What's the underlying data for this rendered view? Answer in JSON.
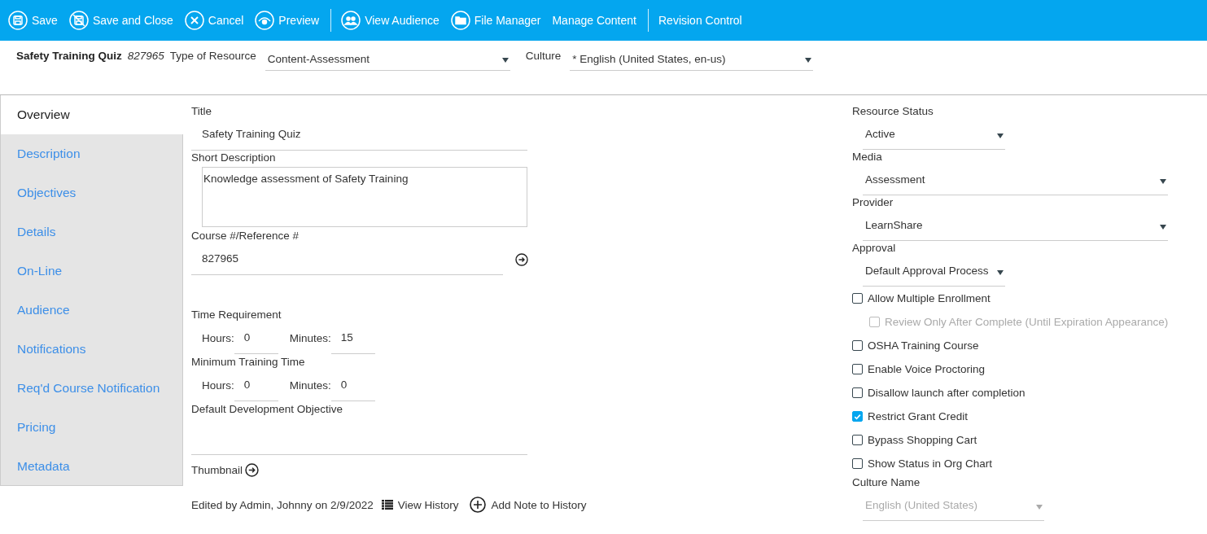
{
  "toolbar": {
    "groups": [
      [
        {
          "label": "Save",
          "kind": "save"
        },
        {
          "label": "Save and Close",
          "kind": "saveclose"
        },
        {
          "label": "Cancel",
          "kind": "cancel"
        },
        {
          "label": "Preview",
          "kind": "preview"
        }
      ],
      [
        {
          "label": "View Audience",
          "kind": "audience"
        },
        {
          "label": "File Manager",
          "kind": "folder"
        },
        {
          "label": "Manage Content",
          "kind": "text"
        }
      ],
      [
        {
          "label": "Revision Control",
          "kind": "text"
        }
      ]
    ]
  },
  "header": {
    "title": "Safety Training Quiz",
    "number": "827965",
    "type_label": "Type of Resource",
    "type_value": "Content-Assessment",
    "culture_label": "Culture",
    "culture_value": "* English (United States, en-us)"
  },
  "tabs": [
    {
      "label": "Overview",
      "selected": true
    },
    {
      "label": "Description",
      "selected": false
    },
    {
      "label": "Objectives",
      "selected": false
    },
    {
      "label": "Details",
      "selected": false
    },
    {
      "label": "On-Line",
      "selected": false
    },
    {
      "label": "Audience",
      "selected": false
    },
    {
      "label": "Notifications",
      "selected": false
    },
    {
      "label": "Req'd Course Notification",
      "selected": false
    },
    {
      "label": "Pricing",
      "selected": false
    },
    {
      "label": "Metadata",
      "selected": false
    }
  ],
  "form": {
    "title_label": "Title",
    "title_value": "Safety Training Quiz",
    "short_label": "Short Description",
    "short_value": "Knowledge assessment of Safety Training",
    "course_label": "Course #/Reference #",
    "course_value": "827965",
    "times": [
      {
        "label": "Time Requirement",
        "hours_label": "Hours:",
        "hours": "0",
        "minutes_label": "Minutes:",
        "minutes": "15"
      },
      {
        "label": "Minimum Training Time",
        "hours_label": "Hours:",
        "hours": "0",
        "minutes_label": "Minutes:",
        "minutes": "0"
      }
    ],
    "objective_label": "Default Development Objective",
    "thumbnail_label": "Thumbnail",
    "edited": "Edited by Admin, Johnny on 2/9/2022",
    "view_history": "View History",
    "add_note": "Add Note to History"
  },
  "side": {
    "selects": [
      {
        "label": "Resource Status",
        "value": "Active"
      },
      {
        "label": "Media",
        "value": "Assessment"
      },
      {
        "label": "Provider",
        "value": "LearnShare"
      },
      {
        "label": "Approval",
        "value": "Default Approval Process"
      }
    ],
    "checkboxes": [
      {
        "label": "Allow Multiple Enrollment",
        "checked": false,
        "disabled": false,
        "children": [
          {
            "label": "Review Only After Complete (Until Expiration Appearance)",
            "checked": false,
            "disabled": true
          }
        ]
      },
      {
        "label": "OSHA Training Course",
        "checked": false,
        "disabled": false
      },
      {
        "label": "Enable Voice Proctoring",
        "checked": false,
        "disabled": false
      },
      {
        "label": "Disallow launch after completion",
        "checked": false,
        "disabled": false
      },
      {
        "label": "Restrict Grant Credit",
        "checked": true,
        "disabled": false
      },
      {
        "label": "Bypass Shopping Cart",
        "checked": false,
        "disabled": false
      },
      {
        "label": "Show Status in Org Chart",
        "checked": false,
        "disabled": false
      }
    ],
    "culture": {
      "label": "Culture Name",
      "value": "English (United States)",
      "disabled": true
    }
  }
}
